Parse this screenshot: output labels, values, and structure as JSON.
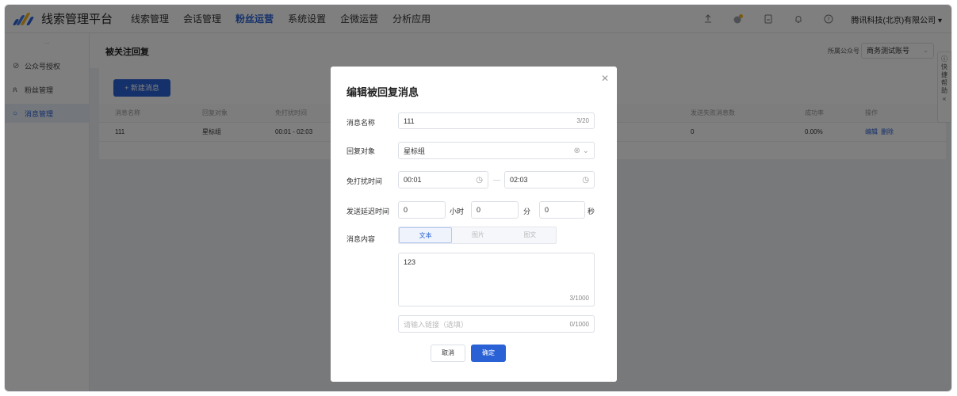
{
  "header": {
    "brand": "线索管理平台",
    "nav": [
      "线索管理",
      "会话管理",
      "粉丝运营",
      "系统设置",
      "企微运营",
      "分析应用"
    ],
    "active_nav_index": 2,
    "org_name": "腾讯科技(北京)有限公司",
    "icons": [
      "upload-icon",
      "badge-icon",
      "document-icon",
      "bell-icon",
      "help-icon"
    ]
  },
  "sidebar": {
    "top_text": "...",
    "items": [
      {
        "label": "公众号授权",
        "icon": "check-circle-icon"
      },
      {
        "label": "粉丝管理",
        "icon": "user-icon"
      },
      {
        "label": "消息管理",
        "icon": "message-icon"
      }
    ],
    "active_index": 2
  },
  "page": {
    "title": "被关注回复",
    "account_label": "所属公众号",
    "account_value": "商务测试账号",
    "new_button": "+ 新建消息",
    "columns": [
      "消息名称",
      "回复对象",
      "免打扰时间",
      "发送失败消息数",
      "成功率",
      "操作"
    ],
    "rows": [
      {
        "name": "111",
        "target": "星标组",
        "time": "00:01 - 02:03",
        "failed": "0",
        "rate": "0.00%",
        "ops": [
          "编辑",
          "删除"
        ]
      }
    ],
    "help_tab": {
      "icon": "help-icon",
      "text": [
        "快",
        "捷",
        "帮",
        "助"
      ],
      "collapse": "«"
    }
  },
  "modal": {
    "title": "编辑被回复消息",
    "name_label": "消息名称",
    "name_value": "111",
    "name_count": "3/20",
    "target_label": "回复对象",
    "target_value": "星标组",
    "dnd_label": "免打扰时间",
    "dnd_start": "00:01",
    "dnd_sep": "—",
    "dnd_end": "02:03",
    "delay_label": "发送延迟时间",
    "delay_hours": "0",
    "delay_hours_unit": "小时",
    "delay_minutes": "0",
    "delay_minutes_unit": "分",
    "delay_seconds": "0",
    "delay_seconds_unit": "秒",
    "content_label": "消息内容",
    "content_tabs": [
      "文本",
      "图片",
      "图文"
    ],
    "content_tab_active": 0,
    "content_value": "123",
    "content_count": "3/1000",
    "link_placeholder": "请输入链接（选填）",
    "link_count": "0/1000",
    "cancel_label": "取消",
    "ok_label": "确定"
  },
  "colors": {
    "primary": "#2a62d6",
    "mask": "rgba(0,0,0,0.5)"
  }
}
